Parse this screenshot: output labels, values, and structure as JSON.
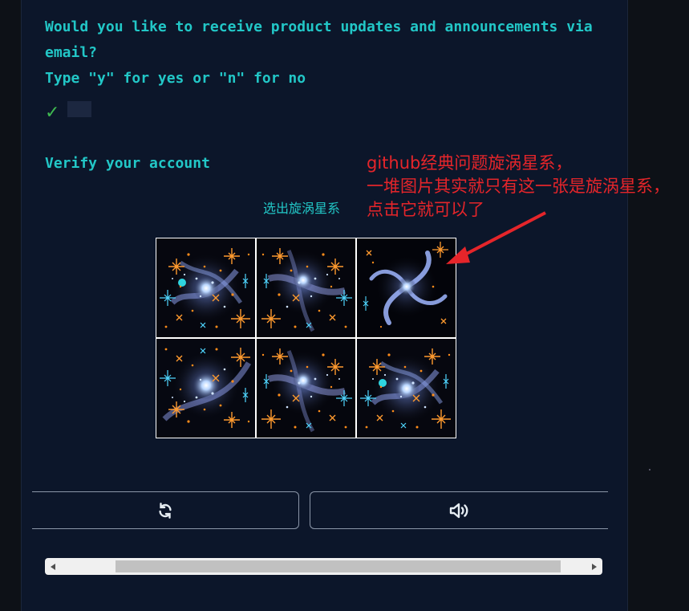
{
  "prompt": {
    "line1": "Would you like to receive product updates and announcements via",
    "line2": "email?",
    "line3": "Type \"y\" for yes or \"n\" for no"
  },
  "check_mark": "✓",
  "verify_heading": "Verify your account",
  "captcha": {
    "title": "选出旋涡星系",
    "tiles": [
      {
        "kind": "star-cluster"
      },
      {
        "kind": "star-cluster"
      },
      {
        "kind": "spiral-galaxy"
      },
      {
        "kind": "star-cluster"
      },
      {
        "kind": "star-cluster"
      },
      {
        "kind": "star-cluster"
      }
    ]
  },
  "annotation": {
    "line1": "github经典问题旋涡星系，",
    "line2": "一堆图片其实就只有这一张是旋涡星系，",
    "line3": "点击它就可以了",
    "color": "#e5252a"
  },
  "buttons": {
    "refresh_icon": "refresh-icon",
    "audio_icon": "volume-icon"
  },
  "colors": {
    "accent": "#22c7c7",
    "success": "#3fb950",
    "background": "#0c162a"
  }
}
